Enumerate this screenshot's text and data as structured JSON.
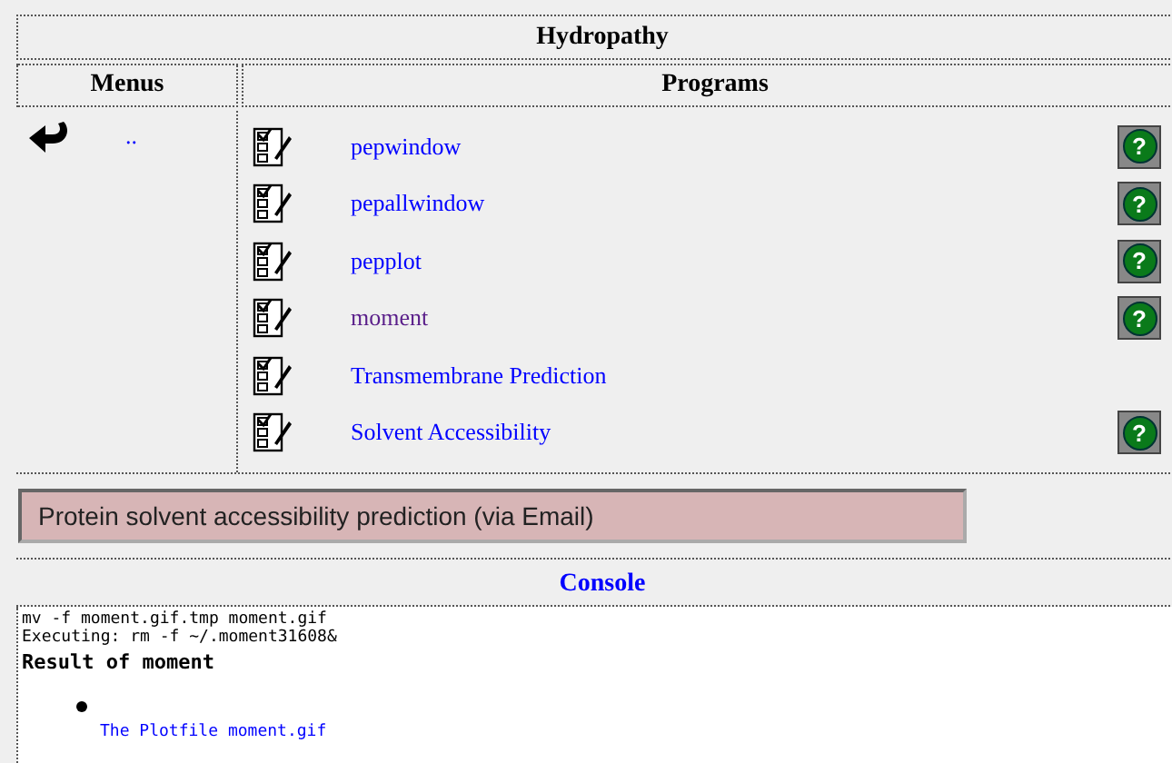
{
  "title": "Hydropathy",
  "columns": [
    "Menus",
    "Programs"
  ],
  "menus": [
    {
      "label": ".."
    }
  ],
  "programs": [
    {
      "label": "pepwindow",
      "visited": false,
      "help": "?"
    },
    {
      "label": "pepallwindow",
      "visited": false,
      "help": "?"
    },
    {
      "label": "pepplot",
      "visited": false,
      "help": "?"
    },
    {
      "label": "moment",
      "visited": true,
      "help": "?"
    },
    {
      "label": "Transmembrane Prediction",
      "visited": false
    },
    {
      "label": "Solvent Accessibility",
      "visited": false,
      "help": "?"
    }
  ],
  "status": "Protein solvent accessibility prediction (via Email)",
  "console": {
    "title": "Console",
    "lines": [
      "mv -f moment.gif.tmp moment.gif",
      "Executing: rm -f ~/.moment31608&"
    ],
    "heading": "Result of moment",
    "links": [
      "The Plotfile moment.gif"
    ]
  }
}
